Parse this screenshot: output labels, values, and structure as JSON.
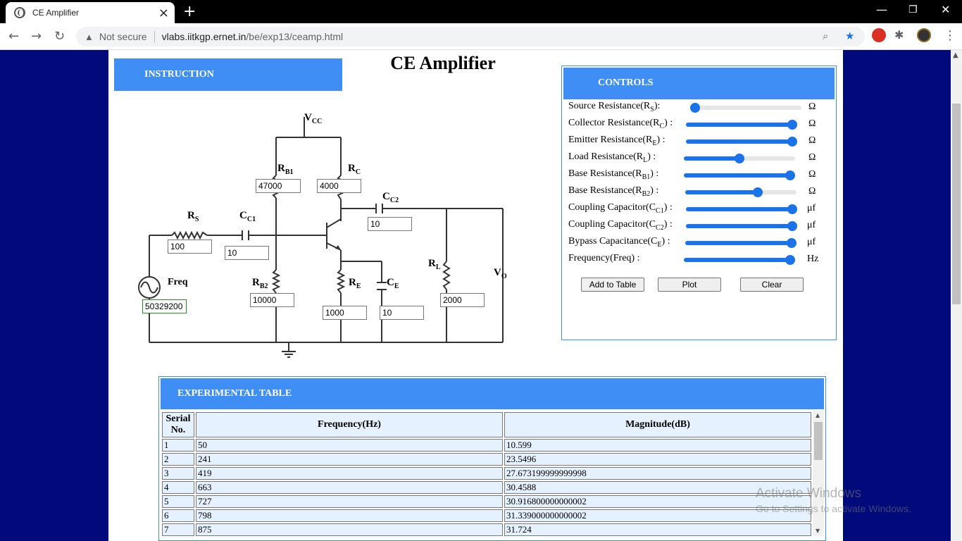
{
  "browser": {
    "tab_title": "CE Amplifier",
    "new_tab": "+",
    "security_label": "Not secure",
    "url_host": "vlabs.iitkgp.ernet.in",
    "url_path": "/be/exp13/ceamp.html"
  },
  "page": {
    "title": "CE Amplifier",
    "instruction_label": "INSTRUCTION"
  },
  "circuit": {
    "labels": {
      "vcc": "V",
      "vcc_sub": "CC",
      "rb1": "R",
      "rb1_sub": "B1",
      "rc": "R",
      "rc_sub": "C",
      "cc2": "C",
      "cc2_sub": "C2",
      "rs": "R",
      "rs_sub": "S",
      "cc1": "C",
      "cc1_sub": "C1",
      "rl": "R",
      "rl_sub": "L",
      "vo": "V",
      "vo_sub": "O",
      "freq": "Freq",
      "rb2": "R",
      "rb2_sub": "B2",
      "re": "R",
      "re_sub": "E",
      "ce": "C",
      "ce_sub": "E"
    },
    "values": {
      "rb1": "47000",
      "rc": "4000",
      "cc2": "10",
      "rs": "100",
      "cc1": "10",
      "freq": "50329200",
      "rb2": "10000",
      "re": "1000",
      "ce": "10",
      "rl": "2000"
    }
  },
  "controls": {
    "header": "CONTROLS",
    "rows": [
      {
        "label": "Source Resistance(R",
        "sub": "S",
        "suffix": "):",
        "unit": "Ω",
        "level": 0.0
      },
      {
        "label": "Collector Resistance(R",
        "sub": "C",
        "suffix": ") :",
        "unit": "Ω",
        "level": 1.0
      },
      {
        "label": "Emitter Resistance(R",
        "sub": "E",
        "suffix": ") :",
        "unit": "Ω",
        "level": 1.0
      },
      {
        "label": "Load Resistance(R",
        "sub": "L",
        "suffix": ") :",
        "unit": "Ω",
        "level": 0.5
      },
      {
        "label": "Base Resistance(R",
        "sub": "B1",
        "suffix": ") :",
        "unit": "Ω",
        "level": 1.0
      },
      {
        "label": "Base Resistance(R",
        "sub": "B2",
        "suffix": ") :",
        "unit": "Ω",
        "level": 0.67
      },
      {
        "label": "Coupling Capacitor(C",
        "sub": "C1",
        "suffix": ") :",
        "unit": "μf",
        "level": 1.0
      },
      {
        "label": "Coupling Capacitor(C",
        "sub": "C2",
        "suffix": ") :",
        "unit": "μf",
        "level": 1.0
      },
      {
        "label": "Bypass Capacitance(C",
        "sub": "E",
        "suffix": ") :",
        "unit": "μf",
        "level": 1.0
      },
      {
        "label": "Frequency(Freq)",
        "sub": "",
        "suffix": " :",
        "unit": "Hz",
        "level": 1.0
      }
    ],
    "buttons": {
      "add": "Add to Table",
      "plot": "Plot",
      "clear": "Clear"
    }
  },
  "table": {
    "header": "EXPERIMENTAL TABLE",
    "col_serial_1": "Serial",
    "col_serial_2": "No.",
    "col_freq": "Frequency(Hz)",
    "col_mag": "Magnitude(dB)",
    "rows": [
      [
        "1",
        "50",
        "10.599"
      ],
      [
        "2",
        "241",
        "23.5496"
      ],
      [
        "3",
        "419",
        "27.673199999999998"
      ],
      [
        "4",
        "663",
        "30.4588"
      ],
      [
        "5",
        "727",
        "30.916800000000002"
      ],
      [
        "6",
        "798",
        "31.339000000000002"
      ],
      [
        "7",
        "875",
        "31.724"
      ]
    ]
  },
  "watermark": {
    "line1": "Activate Windows",
    "line2": "Go to Settings to activate Windows."
  }
}
